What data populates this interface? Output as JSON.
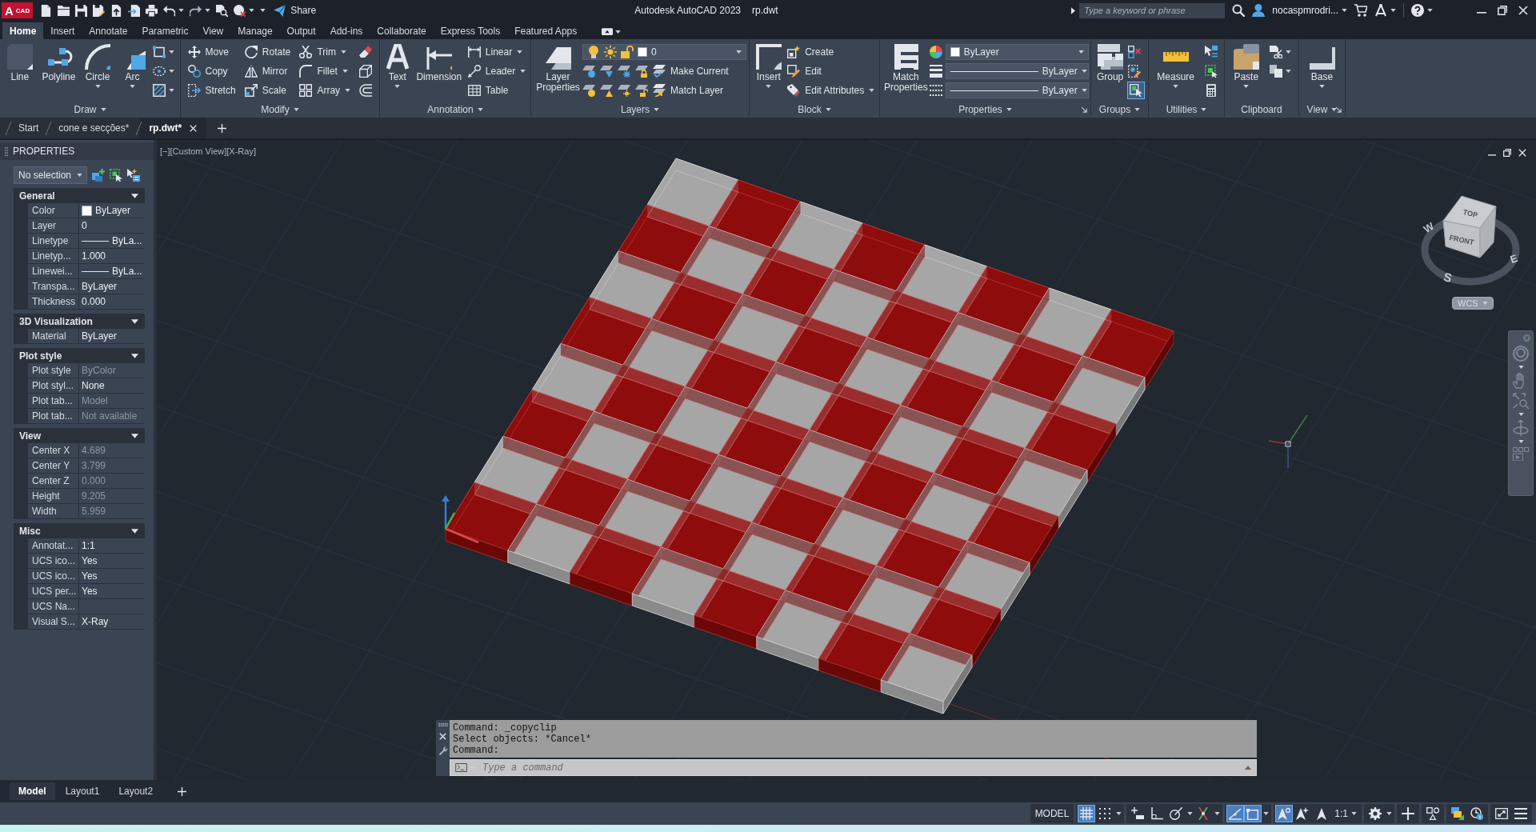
{
  "title_bar": {
    "logo": {
      "letter": "A",
      "label": "CAD"
    },
    "share": "Share",
    "title": "Autodesk AutoCAD 2023",
    "file": "rp.dwt",
    "search": {
      "placeholder": "Type a keyword or phrase"
    },
    "user": "nocaspmrodri..."
  },
  "ribbon_tabs": [
    {
      "label": "Home",
      "selected": true
    },
    {
      "label": "Insert",
      "selected": false
    },
    {
      "label": "Annotate",
      "selected": false
    },
    {
      "label": "Parametric",
      "selected": false
    },
    {
      "label": "View",
      "selected": false
    },
    {
      "label": "Manage",
      "selected": false
    },
    {
      "label": "Output",
      "selected": false
    },
    {
      "label": "Add-ins",
      "selected": false
    },
    {
      "label": "Collaborate",
      "selected": false
    },
    {
      "label": "Express Tools",
      "selected": false
    },
    {
      "label": "Featured Apps",
      "selected": false
    }
  ],
  "ribbon_panels": [
    {
      "title": "Draw",
      "menu": true,
      "launcher": false,
      "columns": [
        {
          "kind": "large",
          "label": "Line",
          "menu": false
        },
        {
          "kind": "large",
          "label": "Polyline",
          "menu": false
        },
        {
          "kind": "large",
          "label": "Circle",
          "menu": true
        },
        {
          "kind": "large",
          "label": "Arc",
          "menu": true
        },
        {
          "kind": "stack",
          "items": [
            {
              "kind": "icon",
              "menu": true,
              "on": false
            },
            {
              "kind": "icon",
              "menu": true,
              "on": false
            },
            {
              "kind": "icon",
              "menu": true,
              "on": false
            }
          ]
        }
      ]
    },
    {
      "title": "Modify",
      "menu": true,
      "launcher": false,
      "columns": [
        {
          "kind": "stack",
          "items": [
            {
              "kind": "button",
              "label": "Move",
              "menu": false
            },
            {
              "kind": "button",
              "label": "Copy",
              "menu": false
            },
            {
              "kind": "button",
              "label": "Stretch",
              "menu": false
            }
          ]
        },
        {
          "kind": "stack",
          "items": [
            {
              "kind": "button",
              "label": "Rotate",
              "menu": false
            },
            {
              "kind": "button",
              "label": "Mirror",
              "menu": false
            },
            {
              "kind": "button",
              "label": "Scale",
              "menu": false
            }
          ]
        },
        {
          "kind": "stack",
          "items": [
            {
              "kind": "button",
              "label": "Trim",
              "menu": true
            },
            {
              "kind": "button",
              "label": "Fillet",
              "menu": true
            },
            {
              "kind": "button",
              "label": "Array",
              "menu": true
            }
          ]
        },
        {
          "kind": "stack",
          "items": [
            {
              "kind": "icon",
              "menu": false,
              "on": false
            },
            {
              "kind": "icon",
              "menu": false,
              "on": false
            },
            {
              "kind": "icon",
              "menu": false,
              "on": false
            }
          ]
        }
      ]
    },
    {
      "title": "Annotation",
      "menu": true,
      "launcher": false,
      "columns": [
        {
          "kind": "large",
          "label": "Text",
          "menu": true
        },
        {
          "kind": "large",
          "label": "Dimension",
          "menu": false
        },
        {
          "kind": "stack",
          "items": [
            {
              "kind": "button",
              "label": "Linear",
              "menu": true
            },
            {
              "kind": "button",
              "label": "Leader",
              "menu": true
            },
            {
              "kind": "button",
              "label": "Table",
              "menu": false
            }
          ]
        }
      ]
    },
    {
      "title": "Layers",
      "menu": true,
      "launcher": false,
      "columns": [
        {
          "kind": "large",
          "label": "Layer Properties",
          "menu": false
        },
        {
          "kind": "stack",
          "items": [
            {
              "kind": "combo",
              "value": "0",
              "color": "#ffffff"
            },
            {
              "kind": "tools",
              "label": "Make Current"
            },
            {
              "kind": "tools",
              "label": "Match Layer"
            }
          ]
        }
      ]
    },
    {
      "title": "Block",
      "menu": true,
      "launcher": false,
      "columns": [
        {
          "kind": "large",
          "label": "Insert",
          "menu": true
        },
        {
          "kind": "stack",
          "items": [
            {
              "kind": "button",
              "label": "Create",
              "menu": false
            },
            {
              "kind": "button",
              "label": "Edit",
              "menu": false
            },
            {
              "kind": "button",
              "label": "Edit Attributes",
              "menu": true
            }
          ]
        }
      ]
    },
    {
      "title": "Properties",
      "menu": true,
      "launcher": true,
      "columns": [
        {
          "kind": "large",
          "label": "Match Properties",
          "menu": false
        },
        {
          "kind": "stack",
          "items": [
            {
              "kind": "combo",
              "value": "ByLayer",
              "color": "#ffffff",
              "line": false
            },
            {
              "kind": "combo",
              "value": "ByLayer",
              "line": true
            },
            {
              "kind": "combo",
              "value": "ByLayer",
              "line": true
            }
          ]
        }
      ]
    },
    {
      "title": "Groups",
      "menu": true,
      "launcher": false,
      "columns": [
        {
          "kind": "large",
          "label": "Group",
          "menu": false
        },
        {
          "kind": "stack",
          "items": [
            {
              "kind": "icon",
              "menu": false,
              "on": false
            },
            {
              "kind": "icon",
              "menu": false,
              "on": false
            },
            {
              "kind": "icon",
              "menu": false,
              "on": true
            }
          ]
        }
      ]
    },
    {
      "title": "Utilities",
      "menu": true,
      "launcher": false,
      "columns": [
        {
          "kind": "large",
          "label": "Measure",
          "menu": true
        },
        {
          "kind": "stack",
          "items": [
            {
              "kind": "icon",
              "menu": false,
              "on": false
            },
            {
              "kind": "icon",
              "menu": false,
              "on": false
            },
            {
              "kind": "icon",
              "menu": false,
              "on": false
            }
          ]
        }
      ]
    },
    {
      "title": "Clipboard",
      "menu": false,
      "launcher": false,
      "columns": [
        {
          "kind": "large",
          "label": "Paste",
          "menu": true
        },
        {
          "kind": "stack",
          "items": [
            {
              "kind": "icon",
              "menu": true,
              "on": false
            },
            {
              "kind": "icon",
              "menu": true,
              "on": false
            }
          ]
        }
      ]
    },
    {
      "title": "View",
      "menu": true,
      "launcher": true,
      "columns": [
        {
          "kind": "large",
          "label": "Base",
          "menu": true
        }
      ]
    }
  ],
  "document_tabs": [
    {
      "label": "Start",
      "selected": false
    },
    {
      "label": "cone e secções*",
      "selected": false
    },
    {
      "label": "rp.dwt*",
      "selected": true
    }
  ],
  "properties_palette": {
    "title": "PROPERTIES",
    "selection": "No selection",
    "sections": [
      {
        "title": "General",
        "expanded": true,
        "rows": [
          {
            "label": "Color",
            "kind": "swatch",
            "color": "#ffffff",
            "value": "ByLayer",
            "disabled": false
          },
          {
            "label": "Layer",
            "kind": "text",
            "value": "0",
            "disabled": false
          },
          {
            "label": "Linetype",
            "kind": "line",
            "value": "ByLa...",
            "disabled": false
          },
          {
            "label": "Linetyp...",
            "kind": "text",
            "value": "1.000",
            "disabled": false
          },
          {
            "label": "Linewei...",
            "kind": "line",
            "value": "ByLa...",
            "disabled": false
          },
          {
            "label": "Transpa...",
            "kind": "text",
            "value": "ByLayer",
            "disabled": false
          },
          {
            "label": "Thickness",
            "kind": "text",
            "value": "0.000",
            "disabled": false
          }
        ]
      },
      {
        "title": "3D Visualization",
        "expanded": true,
        "rows": [
          {
            "label": "Material",
            "kind": "text",
            "value": "ByLayer",
            "disabled": false
          }
        ]
      },
      {
        "title": "Plot style",
        "expanded": true,
        "rows": [
          {
            "label": "Plot style",
            "kind": "text",
            "value": "ByColor",
            "disabled": true
          },
          {
            "label": "Plot styl...",
            "kind": "text",
            "value": "None",
            "disabled": false
          },
          {
            "label": "Plot tab...",
            "kind": "text",
            "value": "Model",
            "disabled": true
          },
          {
            "label": "Plot tab...",
            "kind": "text",
            "value": "Not available",
            "disabled": true
          }
        ]
      },
      {
        "title": "View",
        "expanded": true,
        "rows": [
          {
            "label": "Center X",
            "kind": "text",
            "value": "4.689",
            "disabled": true
          },
          {
            "label": "Center Y",
            "kind": "text",
            "value": "3.799",
            "disabled": true
          },
          {
            "label": "Center Z",
            "kind": "text",
            "value": "0.000",
            "disabled": true
          },
          {
            "label": "Height",
            "kind": "text",
            "value": "9.205",
            "disabled": true
          },
          {
            "label": "Width",
            "kind": "text",
            "value": "5.959",
            "disabled": true
          }
        ]
      },
      {
        "title": "Misc",
        "expanded": true,
        "rows": [
          {
            "label": "Annotat...",
            "kind": "text",
            "value": "1:1",
            "disabled": false
          },
          {
            "label": "UCS ico...",
            "kind": "text",
            "value": "Yes",
            "disabled": false
          },
          {
            "label": "UCS ico...",
            "kind": "text",
            "value": "Yes",
            "disabled": false
          },
          {
            "label": "UCS per...",
            "kind": "text",
            "value": "Yes",
            "disabled": false
          },
          {
            "label": "UCS Na...",
            "kind": "text",
            "disabled": false
          },
          {
            "label": "Visual S...",
            "kind": "text",
            "value": "X-Ray",
            "disabled": false
          }
        ]
      }
    ]
  },
  "viewport": {
    "controls": [
      "[−]",
      "[Custom View]",
      "[X-Ray]"
    ],
    "viewcube": {
      "top": "TOP",
      "front": "FRONT",
      "west": "W",
      "east": "E",
      "south": "S"
    },
    "ucs": "WCS"
  },
  "command_line": {
    "history": [
      "Command: _copyclip",
      "Select objects: *Cancel*",
      "Command:"
    ],
    "placeholder": "Type a command"
  },
  "layout_tabs": [
    {
      "label": "Model",
      "selected": true
    },
    {
      "label": "Layout1",
      "selected": false
    },
    {
      "label": "Layout2",
      "selected": false
    }
  ],
  "status_bar": {
    "groups": [
      [
        {
          "kind": "label",
          "label": "MODEL",
          "menu": false
        }
      ],
      [
        {
          "kind": "toggle",
          "on": true,
          "menu": false
        },
        {
          "kind": "toggle",
          "on": false,
          "menu": true
        }
      ],
      [
        {
          "kind": "toggle",
          "on": false,
          "menu": false
        },
        {
          "kind": "toggle",
          "on": false,
          "menu": false
        },
        {
          "kind": "toggle",
          "on": false,
          "menu": true
        },
        {
          "kind": "toggle",
          "on": false,
          "menu": true
        }
      ],
      [
        {
          "kind": "toggle",
          "on": true,
          "menu": false
        },
        {
          "kind": "toggle",
          "on": true,
          "menu": true
        }
      ],
      [
        {
          "kind": "toggle",
          "on": true,
          "menu": false
        },
        {
          "kind": "toggle",
          "on": false,
          "menu": false
        },
        {
          "kind": "button",
          "menu": false
        },
        {
          "kind": "label",
          "label": "1:1",
          "menu": true
        }
      ],
      [
        {
          "kind": "button",
          "menu": true
        }
      ],
      [
        {
          "kind": "button",
          "menu": false
        }
      ],
      [
        {
          "kind": "button",
          "menu": false
        }
      ],
      [
        {
          "kind": "button",
          "menu": false
        },
        {
          "kind": "button",
          "menu": false
        }
      ],
      [
        {
          "kind": "button",
          "menu": false
        },
        {
          "kind": "button",
          "menu": false
        }
      ]
    ]
  }
}
